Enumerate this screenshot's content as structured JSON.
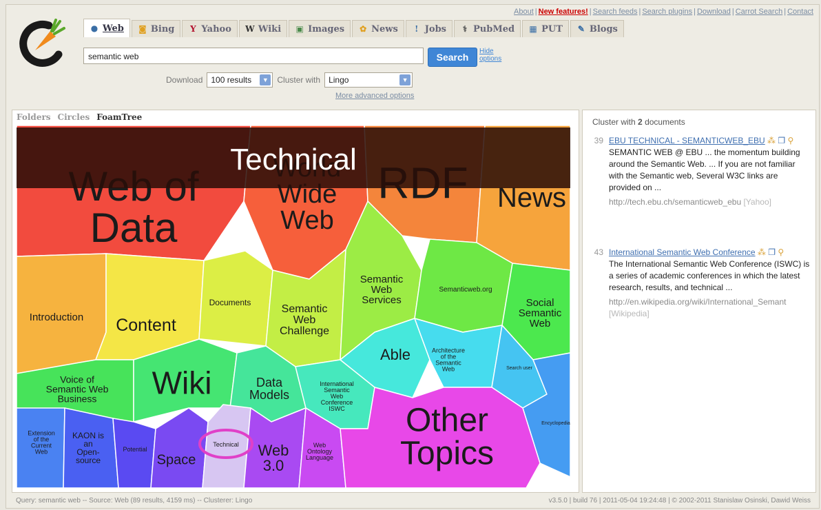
{
  "top_links": [
    {
      "label": "About",
      "style": "normal"
    },
    {
      "label": "New features!",
      "style": "new"
    },
    {
      "label": "Search feeds",
      "style": "normal"
    },
    {
      "label": "Search plugins",
      "style": "normal"
    },
    {
      "label": "Download",
      "style": "normal"
    },
    {
      "label": "Carrot Search",
      "style": "normal"
    },
    {
      "label": "Contact",
      "style": "normal"
    }
  ],
  "tabs": [
    {
      "label": "Web",
      "icon": "globe-icon",
      "glyph": "●",
      "color": "#3a6ea5",
      "active": true
    },
    {
      "label": "Bing",
      "icon": "bing-icon",
      "glyph": "◙",
      "color": "#e0a020",
      "active": false
    },
    {
      "label": "Yahoo",
      "icon": "yahoo-icon",
      "glyph": "Y",
      "color": "#b2102d",
      "active": false
    },
    {
      "label": "Wiki",
      "icon": "wiki-icon",
      "glyph": "W",
      "color": "#333333",
      "active": false
    },
    {
      "label": "Images",
      "icon": "images-icon",
      "glyph": "▣",
      "color": "#4a8a4a",
      "active": false
    },
    {
      "label": "News",
      "icon": "news-icon",
      "glyph": "✿",
      "color": "#e0a020",
      "active": false
    },
    {
      "label": "Jobs",
      "icon": "jobs-icon",
      "glyph": "!",
      "color": "#3a6ea5",
      "active": false
    },
    {
      "label": "PubMed",
      "icon": "pubmed-icon",
      "glyph": "⚕",
      "color": "#555555",
      "active": false
    },
    {
      "label": "PUT",
      "icon": "put-icon",
      "glyph": "▦",
      "color": "#3a6ea5",
      "active": false
    },
    {
      "label": "Blogs",
      "icon": "blogs-icon",
      "glyph": "✎",
      "color": "#3a6ea5",
      "active": false
    }
  ],
  "search": {
    "query": "semantic web",
    "button": "Search",
    "hide_options": "Hide options"
  },
  "options": {
    "download_label": "Download",
    "download_value": "100 results",
    "cluster_label": "Cluster with",
    "cluster_value": "Lingo",
    "more": "More advanced options"
  },
  "viz_tabs": [
    {
      "label": "Folders",
      "active": false
    },
    {
      "label": "Circles",
      "active": false
    },
    {
      "label": "FoamTree",
      "active": true
    }
  ],
  "foamtree": {
    "selected_label": "Technical",
    "cells": [
      {
        "lines": [
          "Web of",
          "Data"
        ],
        "color": "#f24b3e"
      },
      {
        "lines": [
          "World",
          "Wide",
          "Web"
        ],
        "color": "#f65f3b"
      },
      {
        "lines": [
          "RDF"
        ],
        "color": "#f4853b"
      },
      {
        "lines": [
          "News"
        ],
        "color": "#f6a43c"
      },
      {
        "lines": [
          "Introduction"
        ],
        "color": "#f6b33f"
      },
      {
        "lines": [
          "Content"
        ],
        "color": "#f4e646"
      },
      {
        "lines": [
          "Documents"
        ],
        "color": "#dcee45"
      },
      {
        "lines": [
          "Semantic",
          "Web",
          "Challenge"
        ],
        "color": "#c3ee45"
      },
      {
        "lines": [
          "Semantic",
          "Web",
          "Services"
        ],
        "color": "#9cec45"
      },
      {
        "lines": [
          "Semanticweb.org"
        ],
        "color": "#6ee845"
      },
      {
        "lines": [
          "Social",
          "Semantic",
          "Web"
        ],
        "color": "#4ce84e"
      },
      {
        "lines": [
          "Voice of",
          "Semantic Web",
          "Business"
        ],
        "color": "#47e35a"
      },
      {
        "lines": [
          "Wiki"
        ],
        "color": "#45e572"
      },
      {
        "lines": [
          "Data",
          "Models"
        ],
        "color": "#45e59a"
      },
      {
        "lines": [
          "International",
          "Semantic",
          "Web",
          "Conference",
          "ISWC"
        ],
        "color": "#46e8bd"
      },
      {
        "lines": [
          "Able"
        ],
        "color": "#46e8dc"
      },
      {
        "lines": [
          "Architecture",
          "of the",
          "Semantic",
          "Web"
        ],
        "color": "#46dcee"
      },
      {
        "lines": [
          "Search user"
        ],
        "color": "#45c4f2"
      },
      {
        "lines": [
          "Encyclopedia"
        ],
        "color": "#459cf2"
      },
      {
        "lines": [
          "Extension",
          "of the",
          "Current",
          "Web"
        ],
        "color": "#4a82f2"
      },
      {
        "lines": [
          "KAON is",
          "an",
          "Open-",
          "source"
        ],
        "color": "#4a60f2"
      },
      {
        "lines": [
          "Potential"
        ],
        "color": "#5a4af2"
      },
      {
        "lines": [
          "Space"
        ],
        "color": "#7a4af2"
      },
      {
        "lines": [
          "Technical"
        ],
        "color": "#d7c6f2"
      },
      {
        "lines": [
          "Web",
          "3.0"
        ],
        "color": "#a94af2"
      },
      {
        "lines": [
          "Web",
          "Ontology",
          "Language"
        ],
        "color": "#c94af2"
      },
      {
        "lines": [
          "Other",
          "Topics"
        ],
        "color": "#e848e8"
      }
    ]
  },
  "sidebar": {
    "header_prefix": "Cluster with",
    "count": "2",
    "header_suffix": "documents",
    "docs": [
      {
        "num": "39",
        "title": "EBU TECHNICAL - SEMANTICWEB_EBU",
        "snippet": "SEMANTIC WEB @ EBU ... the momentum building around the Semantic Web. ... If you are not familiar with the Semantic web, Several W3C links are provided on ...",
        "url": "http://tech.ebu.ch/semanticweb_ebu",
        "source": "[Yahoo]"
      },
      {
        "num": "43",
        "title": "International Semantic Web Conference",
        "snippet": "The International Semantic Web Conference (ISWC) is a series of academic conferences in which the latest research, results, and technical ...",
        "url": "http://en.wikipedia.org/wiki/International_Semant",
        "source": "[Wikipedia]"
      }
    ]
  },
  "status": {
    "left": "Query: semantic web -- Source: Web (89 results, 4159 ms) -- Clusterer: Lingo",
    "right": "v3.5.0 | build 76 | 2011-05-04 19:24:48 | © 2002-2011 Stanislaw Osinski, Dawid Weiss"
  }
}
